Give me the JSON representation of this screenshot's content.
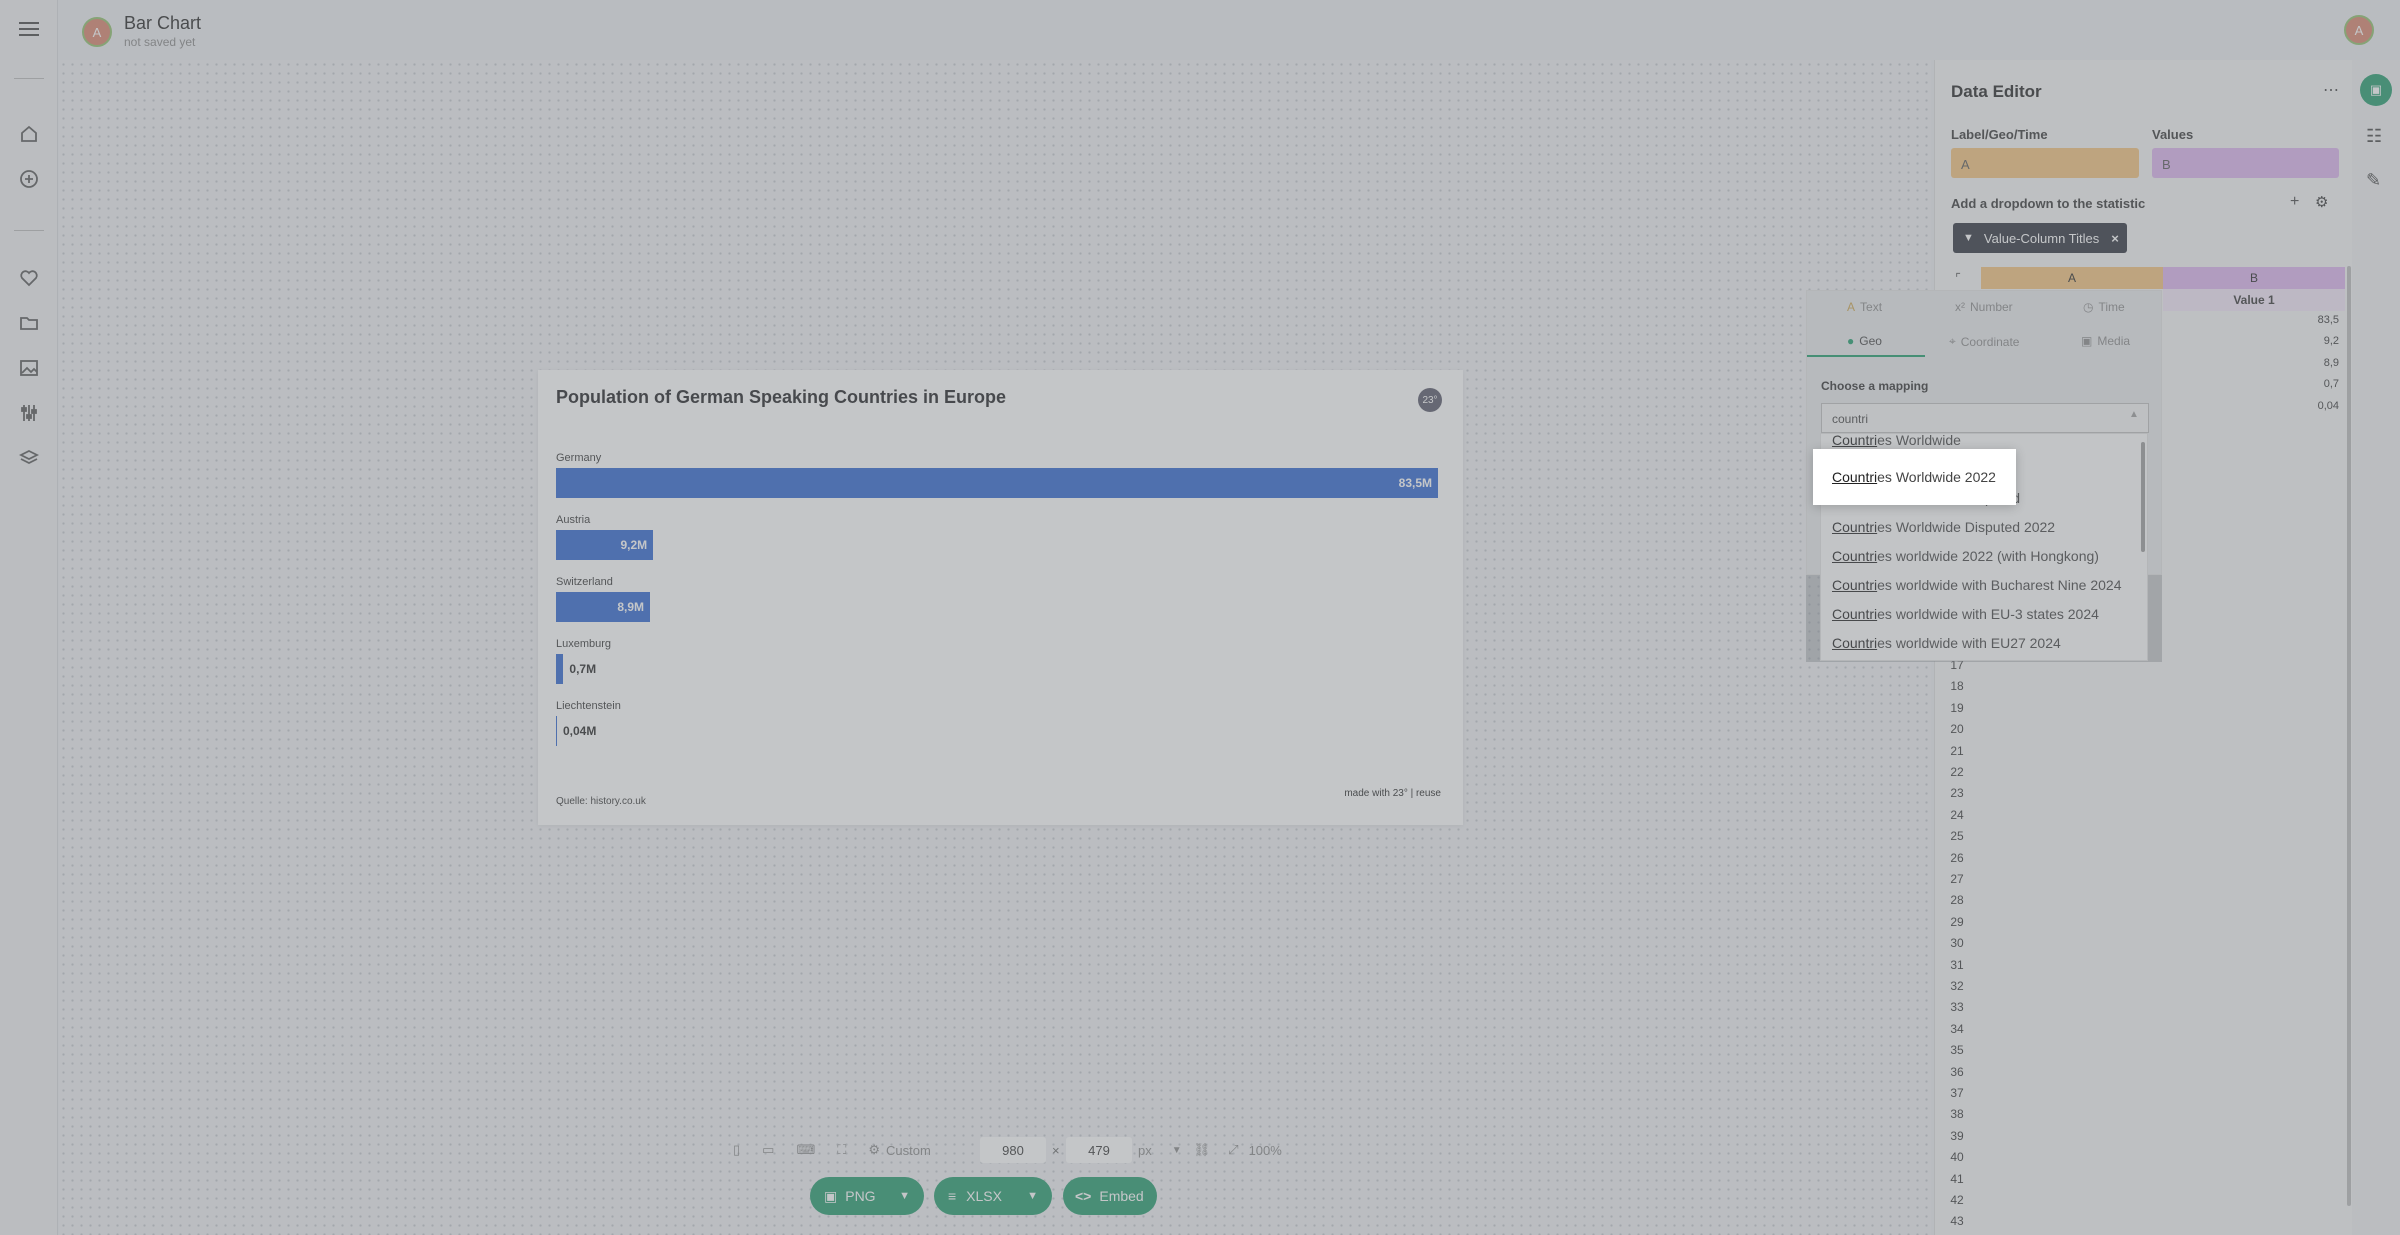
{
  "app": {
    "title": "Bar Chart",
    "subtitle": "not saved yet",
    "avatar_letter": "A"
  },
  "sidebar": {
    "icons": [
      "menu-icon",
      "home-icon",
      "add-icon",
      "heart-icon",
      "folder-icon",
      "image-icon",
      "sliders-icon",
      "layers-icon"
    ]
  },
  "chart": {
    "title": "Population of German Speaking Countries in Europe",
    "logo": "23°",
    "source": "Quelle: history.co.uk",
    "credit": "made with 23° | reuse"
  },
  "chart_data": {
    "type": "bar",
    "orientation": "horizontal",
    "title": "Population of German Speaking Countries in Europe",
    "categories": [
      "Germany",
      "Austria",
      "Switzerland",
      "Luxemburg",
      "Liechtenstein"
    ],
    "values": [
      83.5,
      9.2,
      8.9,
      0.7,
      0.04
    ],
    "value_labels": [
      "83,5M",
      "9,2M",
      "8,9M",
      "0,7M",
      "0,04M"
    ],
    "xlim": [
      0,
      83.5
    ],
    "grid": false,
    "color": "#2a63d0"
  },
  "size_toolbar": {
    "preset": "Custom",
    "width": "980",
    "x": "×",
    "height": "479",
    "unit": "px",
    "zoom": "100%"
  },
  "downloads": {
    "png": "PNG",
    "xlsx": "XLSX",
    "embed": "Embed"
  },
  "data_editor": {
    "title": "Data Editor",
    "label_col_title": "Label/Geo/Time",
    "label_col_value": "A",
    "values_col_title": "Values",
    "values_col_value": "B",
    "dropdown_label": "Add a dropdown to the statistic",
    "plus": "+",
    "chip_label": "Value-Column Titles",
    "col_a": "A",
    "col_b": "B",
    "value_header": "Value 1",
    "cells": [
      "83,5",
      "9,2",
      "8,9",
      "0,7",
      "0,04"
    ],
    "row_numbers": [
      "17",
      "18",
      "19",
      "20",
      "21",
      "22",
      "23",
      "24",
      "25",
      "26",
      "27",
      "28",
      "29",
      "30",
      "31",
      "32",
      "33",
      "34",
      "35",
      "36",
      "37",
      "38",
      "39",
      "40",
      "41",
      "42",
      "43"
    ]
  },
  "mapping_popup": {
    "tabs": [
      "Text",
      "Number",
      "Time",
      "Geo",
      "Coordinate",
      "Media"
    ],
    "active_tab": "Geo",
    "choose_label": "Choose a mapping",
    "search_value": "countri",
    "match_prefix": "Countri",
    "options": [
      "es Worldwide",
      "es Worldwide 2022",
      "es Worldwide Disputed",
      "es Worldwide Disputed 2022",
      "es worldwide 2022 (with Hongkong)",
      "es worldwide with Bucharest Nine 2024",
      "es worldwide with EU-3 states 2024",
      "es worldwide with EU27 2024"
    ],
    "highlighted_index": 1
  },
  "colors": {
    "bar": "#2a63d0",
    "accent_green": "#1f9a6a",
    "label_col": "#f4c27a",
    "values_col": "#dcb3ef"
  }
}
